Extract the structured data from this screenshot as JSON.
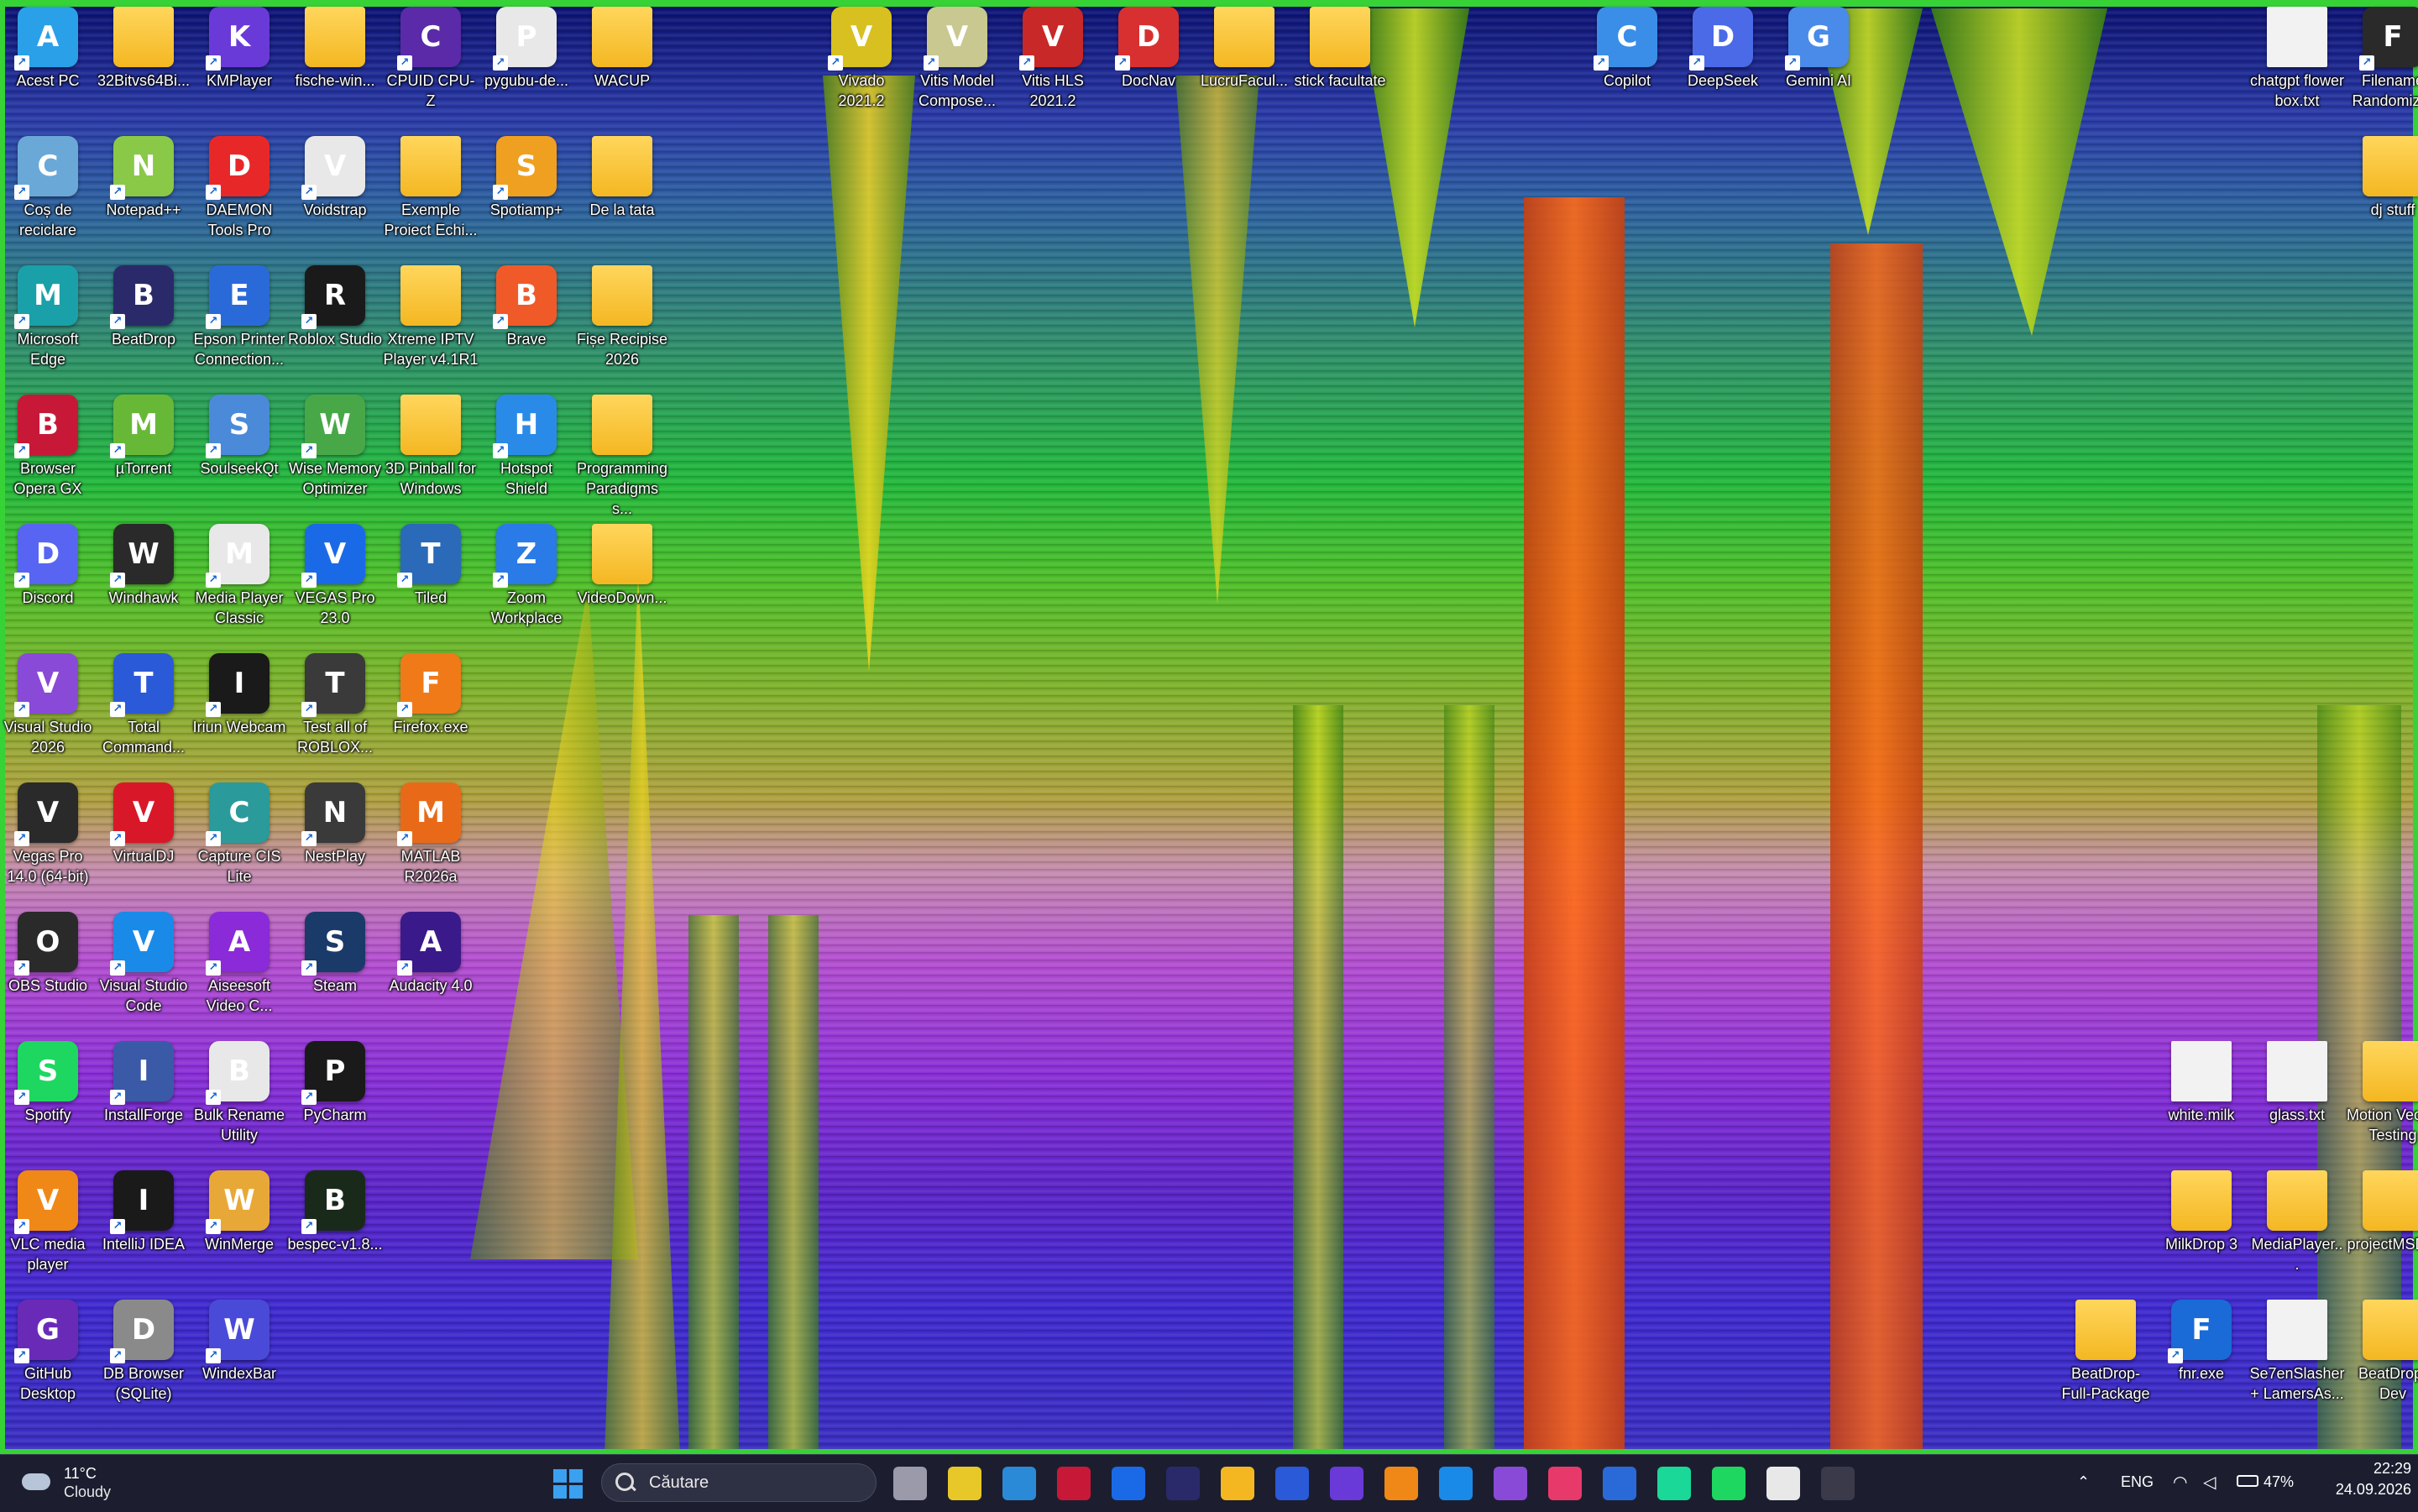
{
  "desktop": {
    "icons": [
      {
        "label": "Acest PC",
        "icon": "monitor-icon",
        "color": "#2aa0e8",
        "col": 0,
        "row": 0
      },
      {
        "label": "32Bitvs64Bi...",
        "icon": "folder-icon",
        "color": "#f4b722",
        "col": 1,
        "row": 0
      },
      {
        "label": "KMPlayer",
        "icon": "kmplayer-icon",
        "color": "#6a3ad8",
        "col": 2,
        "row": 0
      },
      {
        "label": "fische-win...",
        "icon": "folder-icon",
        "color": "#f4b722",
        "col": 3,
        "row": 0
      },
      {
        "label": "CPUID CPU-Z",
        "icon": "cpu-icon",
        "color": "#5a2aa8",
        "col": 4,
        "row": 0
      },
      {
        "label": "pygubu-de...",
        "icon": "python-file-icon",
        "color": "#e8e8e8",
        "col": 5,
        "row": 0
      },
      {
        "label": "WACUP",
        "icon": "folder-icon",
        "color": "#f4b722",
        "col": 6,
        "row": 0
      },
      {
        "label": "Vivado 2021.2",
        "icon": "vivado-icon",
        "color": "#d8c020",
        "col": 8.5,
        "row": 0
      },
      {
        "label": "Vitis Model Compose...",
        "icon": "vitis-model-icon",
        "color": "#c8c890",
        "col": 9.5,
        "row": 0
      },
      {
        "label": "Vitis HLS 2021.2",
        "icon": "vitis-hls-icon",
        "color": "#c82828",
        "col": 10.5,
        "row": 0
      },
      {
        "label": "DocNav",
        "icon": "docnav-icon",
        "color": "#d83030",
        "col": 11.5,
        "row": 0
      },
      {
        "label": "LucruFacul...",
        "icon": "folder-icon",
        "color": "#f4b722",
        "col": 12.5,
        "row": 0
      },
      {
        "label": "stick facultate",
        "icon": "folder-icon",
        "color": "#f4b722",
        "col": 13.5,
        "row": 0
      },
      {
        "label": "Copilot",
        "icon": "copilot-icon",
        "color": "#3a8ee8",
        "col": 16.5,
        "row": 0
      },
      {
        "label": "DeepSeek",
        "icon": "deepseek-icon",
        "color": "#4a6ae8",
        "col": 17.5,
        "row": 0
      },
      {
        "label": "Gemini AI",
        "icon": "gemini-icon",
        "color": "#4a8ae8",
        "col": 18.5,
        "row": 0
      },
      {
        "label": "chatgpt flower box.txt",
        "icon": "text-file-icon",
        "color": "#f2f2f2",
        "col": 23.5,
        "row": 0
      },
      {
        "label": "Filename Randomizer",
        "icon": "app-icon",
        "color": "#2a2a2a",
        "col": 24.5,
        "row": 0
      },
      {
        "label": "Coș de reciclare",
        "icon": "recycle-bin-icon",
        "color": "#6aa8d8",
        "col": 0,
        "row": 1
      },
      {
        "label": "Notepad++",
        "icon": "notepadpp-icon",
        "color": "#8ac848",
        "col": 1,
        "row": 1
      },
      {
        "label": "DAEMON Tools Pro",
        "icon": "daemon-tools-icon",
        "color": "#e82828",
        "col": 2,
        "row": 1
      },
      {
        "label": "Voidstrap",
        "icon": "voidstrap-icon",
        "color": "#e8e8e8",
        "col": 3,
        "row": 1
      },
      {
        "label": "Exemple Proiect Echi...",
        "icon": "folder-icon",
        "color": "#f4b722",
        "col": 4,
        "row": 1
      },
      {
        "label": "Spotiamp+",
        "icon": "spotiamp-icon",
        "color": "#f0a020",
        "col": 5,
        "row": 1
      },
      {
        "label": "De la tata",
        "icon": "folder-icon",
        "color": "#f4b722",
        "col": 6,
        "row": 1
      },
      {
        "label": "dj stuff",
        "icon": "folder-icon",
        "color": "#f4b722",
        "col": 24.5,
        "row": 1
      },
      {
        "label": "Microsoft Edge",
        "icon": "edge-icon",
        "color": "#1aa0a8",
        "col": 0,
        "row": 2
      },
      {
        "label": "BeatDrop",
        "icon": "beatdrop-icon",
        "color": "#2a2a6a",
        "col": 1,
        "row": 2
      },
      {
        "label": "Epson Printer Connection...",
        "icon": "printer-icon",
        "color": "#2a6ad8",
        "col": 2,
        "row": 2
      },
      {
        "label": "Roblox Studio",
        "icon": "roblox-icon",
        "color": "#1a1a1a",
        "col": 3,
        "row": 2
      },
      {
        "label": "Xtreme IPTV Player v4.1R1",
        "icon": "folder-icon",
        "color": "#f4b722",
        "col": 4,
        "row": 2
      },
      {
        "label": "Brave",
        "icon": "brave-icon",
        "color": "#f05a28",
        "col": 5,
        "row": 2
      },
      {
        "label": "Fișe Recipise 2026",
        "icon": "folder-icon",
        "color": "#f4b722",
        "col": 6,
        "row": 2
      },
      {
        "label": "Browser Opera GX",
        "icon": "opera-gx-icon",
        "color": "#c81838",
        "col": 0,
        "row": 3
      },
      {
        "label": "µTorrent",
        "icon": "utorrent-icon",
        "color": "#68b838",
        "col": 1,
        "row": 3
      },
      {
        "label": "SoulseekQt",
        "icon": "soulseek-icon",
        "color": "#4a8ad8",
        "col": 2,
        "row": 3
      },
      {
        "label": "Wise Memory Optimizer",
        "icon": "memory-icon",
        "color": "#48a848",
        "col": 3,
        "row": 3
      },
      {
        "label": "3D Pinball for Windows",
        "icon": "folder-icon",
        "color": "#f4b722",
        "col": 4,
        "row": 3
      },
      {
        "label": "Hotspot Shield",
        "icon": "hotspot-shield-icon",
        "color": "#2a8ae8",
        "col": 5,
        "row": 3
      },
      {
        "label": "Programming Paradigms s...",
        "icon": "folder-icon",
        "color": "#f4b722",
        "col": 6,
        "row": 3
      },
      {
        "label": "Discord",
        "icon": "discord-icon",
        "color": "#5865f2",
        "col": 0,
        "row": 4
      },
      {
        "label": "Windhawk",
        "icon": "windhawk-icon",
        "color": "#2a2a2a",
        "col": 1,
        "row": 4
      },
      {
        "label": "Media Player Classic",
        "icon": "mpc-icon",
        "color": "#e8e8e8",
        "col": 2,
        "row": 4
      },
      {
        "label": "VEGAS Pro 23.0",
        "icon": "vegas-icon",
        "color": "#1a6ae8",
        "col": 3,
        "row": 4
      },
      {
        "label": "Tiled",
        "icon": "tiled-icon",
        "color": "#2a6ab8",
        "col": 4,
        "row": 4
      },
      {
        "label": "Zoom Workplace",
        "icon": "zoom-icon",
        "color": "#2a7ae8",
        "col": 5,
        "row": 4
      },
      {
        "label": "VideoDown...",
        "icon": "folder-icon",
        "color": "#f4b722",
        "col": 6,
        "row": 4
      },
      {
        "label": "Visual Studio 2026",
        "icon": "visual-studio-icon",
        "color": "#8a4ad8",
        "col": 0,
        "row": 5
      },
      {
        "label": "Total Command...",
        "icon": "floppy-icon",
        "color": "#2a5ad8",
        "col": 1,
        "row": 5
      },
      {
        "label": "Iriun Webcam",
        "icon": "webcam-icon",
        "color": "#1a1a1a",
        "col": 2,
        "row": 5
      },
      {
        "label": "Test all of ROBLOX...",
        "icon": "roblox-test-icon",
        "color": "#3a3a3a",
        "col": 3,
        "row": 5
      },
      {
        "label": "Firefox.exe",
        "icon": "firefox-icon",
        "color": "#f07a18",
        "col": 4,
        "row": 5
      },
      {
        "label": "Vegas Pro 14.0 (64-bit)",
        "icon": "vegas14-icon",
        "color": "#2a2a2a",
        "col": 0,
        "row": 6
      },
      {
        "label": "VirtualDJ",
        "icon": "virtualdj-icon",
        "color": "#d81828",
        "col": 1,
        "row": 6
      },
      {
        "label": "Capture CIS Lite",
        "icon": "capture-icon",
        "color": "#2a9a9a",
        "col": 2,
        "row": 6
      },
      {
        "label": "NestPlay",
        "icon": "nestplay-icon",
        "color": "#3a3a3a",
        "col": 3,
        "row": 6
      },
      {
        "label": "MATLAB R2026a",
        "icon": "matlab-icon",
        "color": "#e86a18",
        "col": 4,
        "row": 6
      },
      {
        "label": "OBS Studio",
        "icon": "obs-icon",
        "color": "#2a2a2a",
        "col": 0,
        "row": 7
      },
      {
        "label": "Visual Studio Code",
        "icon": "vscode-icon",
        "color": "#1a8ae8",
        "col": 1,
        "row": 7
      },
      {
        "label": "Aiseesoft Video C...",
        "icon": "aiseesoft-icon",
        "color": "#8a2ad8",
        "col": 2,
        "row": 7
      },
      {
        "label": "Steam",
        "icon": "steam-icon",
        "color": "#1a3a6a",
        "col": 3,
        "row": 7
      },
      {
        "label": "Audacity 4.0",
        "icon": "audacity-icon",
        "color": "#3a1a8a",
        "col": 4,
        "row": 7
      },
      {
        "label": "Spotify",
        "icon": "spotify-icon",
        "color": "#1ed760",
        "col": 0,
        "row": 8
      },
      {
        "label": "InstallForge",
        "icon": "installforge-icon",
        "color": "#3a5aa8",
        "col": 1,
        "row": 8
      },
      {
        "label": "Bulk Rename Utility",
        "icon": "bulk-rename-icon",
        "color": "#e8e8e8",
        "col": 2,
        "row": 8
      },
      {
        "label": "PyCharm",
        "icon": "pycharm-icon",
        "color": "#1a1a1a",
        "col": 3,
        "row": 8
      },
      {
        "label": "white.milk",
        "icon": "file-icon",
        "color": "#f2f2f2",
        "col": 22.5,
        "row": 8
      },
      {
        "label": "glass.txt",
        "icon": "text-file-icon",
        "color": "#f2f2f2",
        "col": 23.5,
        "row": 8
      },
      {
        "label": "Motion Vector Testing",
        "icon": "folder-icon",
        "color": "#f4b722",
        "col": 24.5,
        "row": 8
      },
      {
        "label": "VLC media player",
        "icon": "vlc-icon",
        "color": "#f08818",
        "col": 0,
        "row": 9
      },
      {
        "label": "IntelliJ IDEA",
        "icon": "intellij-icon",
        "color": "#1a1a1a",
        "col": 1,
        "row": 9
      },
      {
        "label": "WinMerge",
        "icon": "winmerge-icon",
        "color": "#e8a838",
        "col": 2,
        "row": 9
      },
      {
        "label": "bespec-v1.8...",
        "icon": "bespec-icon",
        "color": "#1a2a1a",
        "col": 3,
        "row": 9
      },
      {
        "label": "MilkDrop 3",
        "icon": "folder-icon",
        "color": "#f4b722",
        "col": 22.5,
        "row": 9
      },
      {
        "label": "MediaPlayer...",
        "icon": "folder-icon",
        "color": "#f4b722",
        "col": 23.5,
        "row": 9
      },
      {
        "label": "projectMSD...",
        "icon": "folder-icon",
        "color": "#f4b722",
        "col": 24.5,
        "row": 9
      },
      {
        "label": "GitHub Desktop",
        "icon": "github-icon",
        "color": "#6a2ab8",
        "col": 0,
        "row": 10
      },
      {
        "label": "DB Browser (SQLite)",
        "icon": "database-icon",
        "color": "#8a8a8a",
        "col": 1,
        "row": 10
      },
      {
        "label": "WindexBar",
        "icon": "windexbar-icon",
        "color": "#4a4ad8",
        "col": 2,
        "row": 10
      },
      {
        "label": "BeatDrop-Full-Package",
        "icon": "folder-icon",
        "color": "#f4b722",
        "col": 21.5,
        "row": 10
      },
      {
        "label": "fnr.exe",
        "icon": "fnr-icon",
        "color": "#1a6ad8",
        "col": 22.5,
        "row": 10
      },
      {
        "label": "Se7enSlasher + LamersAs...",
        "icon": "file-icon",
        "color": "#f2f2f2",
        "col": 23.5,
        "row": 10
      },
      {
        "label": "BeatDrop-Dev",
        "icon": "folder-icon",
        "color": "#f4b722",
        "col": 24.5,
        "row": 10
      }
    ]
  },
  "taskbar": {
    "weather": {
      "temp": "11°C",
      "desc": "Cloudy",
      "icon": "cloud-icon"
    },
    "search_placeholder": "Căutare",
    "pinned": [
      {
        "icon": "start-icon",
        "color": "#3aa0f0"
      },
      {
        "icon": "task-view-icon",
        "color": "#9a9aaa"
      },
      {
        "icon": "store-icon",
        "color": "#e8c828"
      },
      {
        "icon": "vitis-icon",
        "color": "#2a8ad8"
      },
      {
        "icon": "opera-gx-icon",
        "color": "#c81838"
      },
      {
        "icon": "vegas-icon",
        "color": "#1a6ae8"
      },
      {
        "icon": "beatdrop-icon",
        "color": "#2a2a6a"
      },
      {
        "icon": "file-explorer-icon",
        "color": "#f4b722"
      },
      {
        "icon": "total-commander-icon",
        "color": "#2a5ad8"
      },
      {
        "icon": "kmplayer-icon",
        "color": "#6a3ad8"
      },
      {
        "icon": "vlc-icon",
        "color": "#f08818"
      },
      {
        "icon": "vscode-icon",
        "color": "#1a8ae8"
      },
      {
        "icon": "visual-studio-icon",
        "color": "#8a4ad8"
      },
      {
        "icon": "intellij-icon",
        "color": "#e83a6a"
      },
      {
        "icon": "app-icon",
        "color": "#2a6ad8"
      },
      {
        "icon": "pycharm-icon",
        "color": "#1ad898"
      },
      {
        "icon": "spotify-icon",
        "color": "#1ed760"
      },
      {
        "icon": "chatgpt-icon",
        "color": "#e8e8e8"
      },
      {
        "icon": "terminal-icon",
        "color": "#3a3a4a"
      }
    ],
    "tray": {
      "lang": "ENG",
      "battery": "47%",
      "time": "22:29",
      "date": "24.09.2026"
    }
  }
}
